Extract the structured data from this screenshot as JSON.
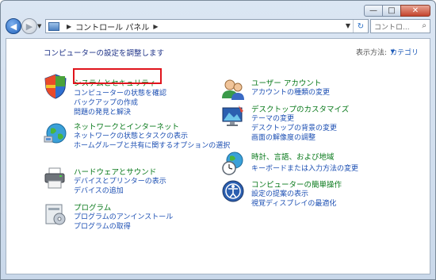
{
  "window": {
    "minimize_icon": "minimize-icon",
    "maximize_icon": "maximize-icon",
    "close_icon": "close-icon",
    "min_glyph": "—",
    "max_glyph": "□",
    "close_glyph": "✕"
  },
  "navbar": {
    "back_glyph": "◀",
    "forward_glyph": "▶",
    "address": "コントロール パネル",
    "search_placeholder": "コントロ..."
  },
  "main": {
    "heading": "コンピューターの設定を調整します",
    "view_by_label": "表示方法:",
    "view_by_value": "カテゴリ"
  },
  "categories": [
    {
      "title": "システムとセキュリティ",
      "icon": "shield-icon",
      "links": [
        "コンピューターの状態を確認",
        "バックアップの作成",
        "問題の発見と解決"
      ]
    },
    {
      "title": "ネットワークとインターネット",
      "icon": "network-globe-icon",
      "links": [
        "ネットワークの状態とタスクの表示",
        "ホームグループと共有に関するオプションの選択"
      ]
    },
    {
      "title": "ハードウェアとサウンド",
      "icon": "printer-icon",
      "links": [
        "デバイスとプリンターの表示",
        "デバイスの追加"
      ]
    },
    {
      "title": "プログラム",
      "icon": "programs-icon",
      "links": [
        "プログラムのアンインストール",
        "プログラムの取得"
      ]
    },
    {
      "title": "ユーザー アカウント",
      "icon": "users-icon",
      "links": [
        "アカウントの種類の変更"
      ]
    },
    {
      "title": "デスクトップのカスタマイズ",
      "icon": "desktop-icon",
      "links": [
        "テーマの変更",
        "デスクトップの背景の変更",
        "画面の解像度の調整"
      ]
    },
    {
      "title": "時計、言語、および地域",
      "icon": "clock-globe-icon",
      "links": [
        "キーボードまたは入力方法の変更"
      ]
    },
    {
      "title": "コンピューターの簡単操作",
      "icon": "ease-of-access-icon",
      "links": [
        "設定の提案の表示",
        "視覚ディスプレイの最適化"
      ]
    }
  ]
}
